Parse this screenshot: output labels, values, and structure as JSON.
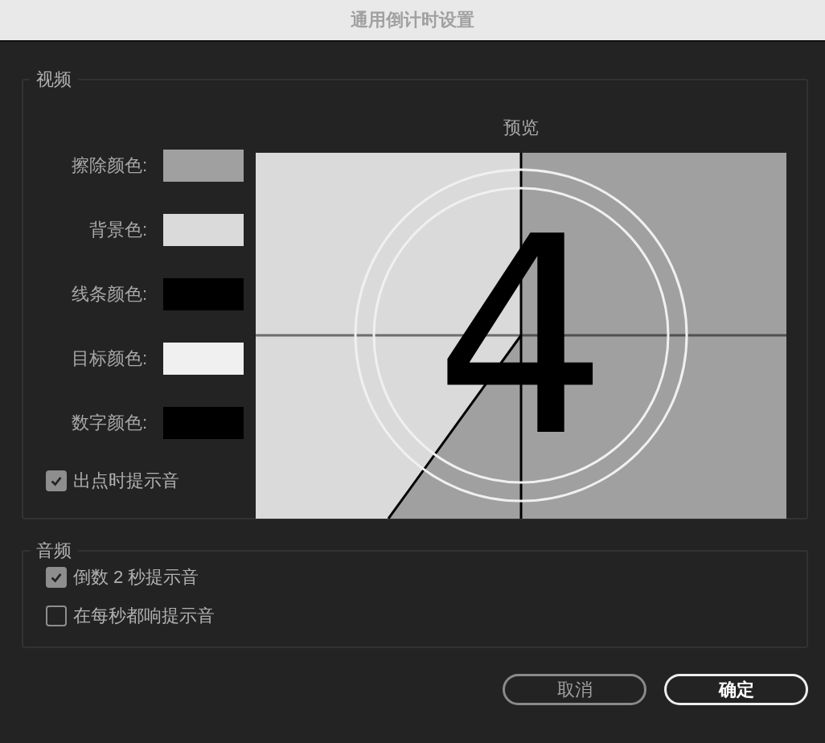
{
  "window": {
    "title": "通用倒计时设置"
  },
  "video": {
    "legend": "视频",
    "swatches": [
      {
        "label": "擦除颜色:",
        "color": "#a0a0a0"
      },
      {
        "label": "背景色:",
        "color": "#dadada"
      },
      {
        "label": "线条颜色:",
        "color": "#000000"
      },
      {
        "label": "目标颜色:",
        "color": "#f0f0f0"
      },
      {
        "label": "数字颜色:",
        "color": "#000000"
      }
    ],
    "checkbox": {
      "label": "出点时提示音",
      "checked": true
    },
    "preview": {
      "title": "预览",
      "digit": "4"
    }
  },
  "audio": {
    "legend": "音频",
    "options": [
      {
        "label": "倒数 2 秒提示音",
        "checked": true
      },
      {
        "label": "在每秒都响提示音",
        "checked": false
      }
    ]
  },
  "buttons": [
    {
      "label": "取消",
      "kind": "secondary"
    },
    {
      "label": "确定",
      "kind": "primary"
    }
  ]
}
